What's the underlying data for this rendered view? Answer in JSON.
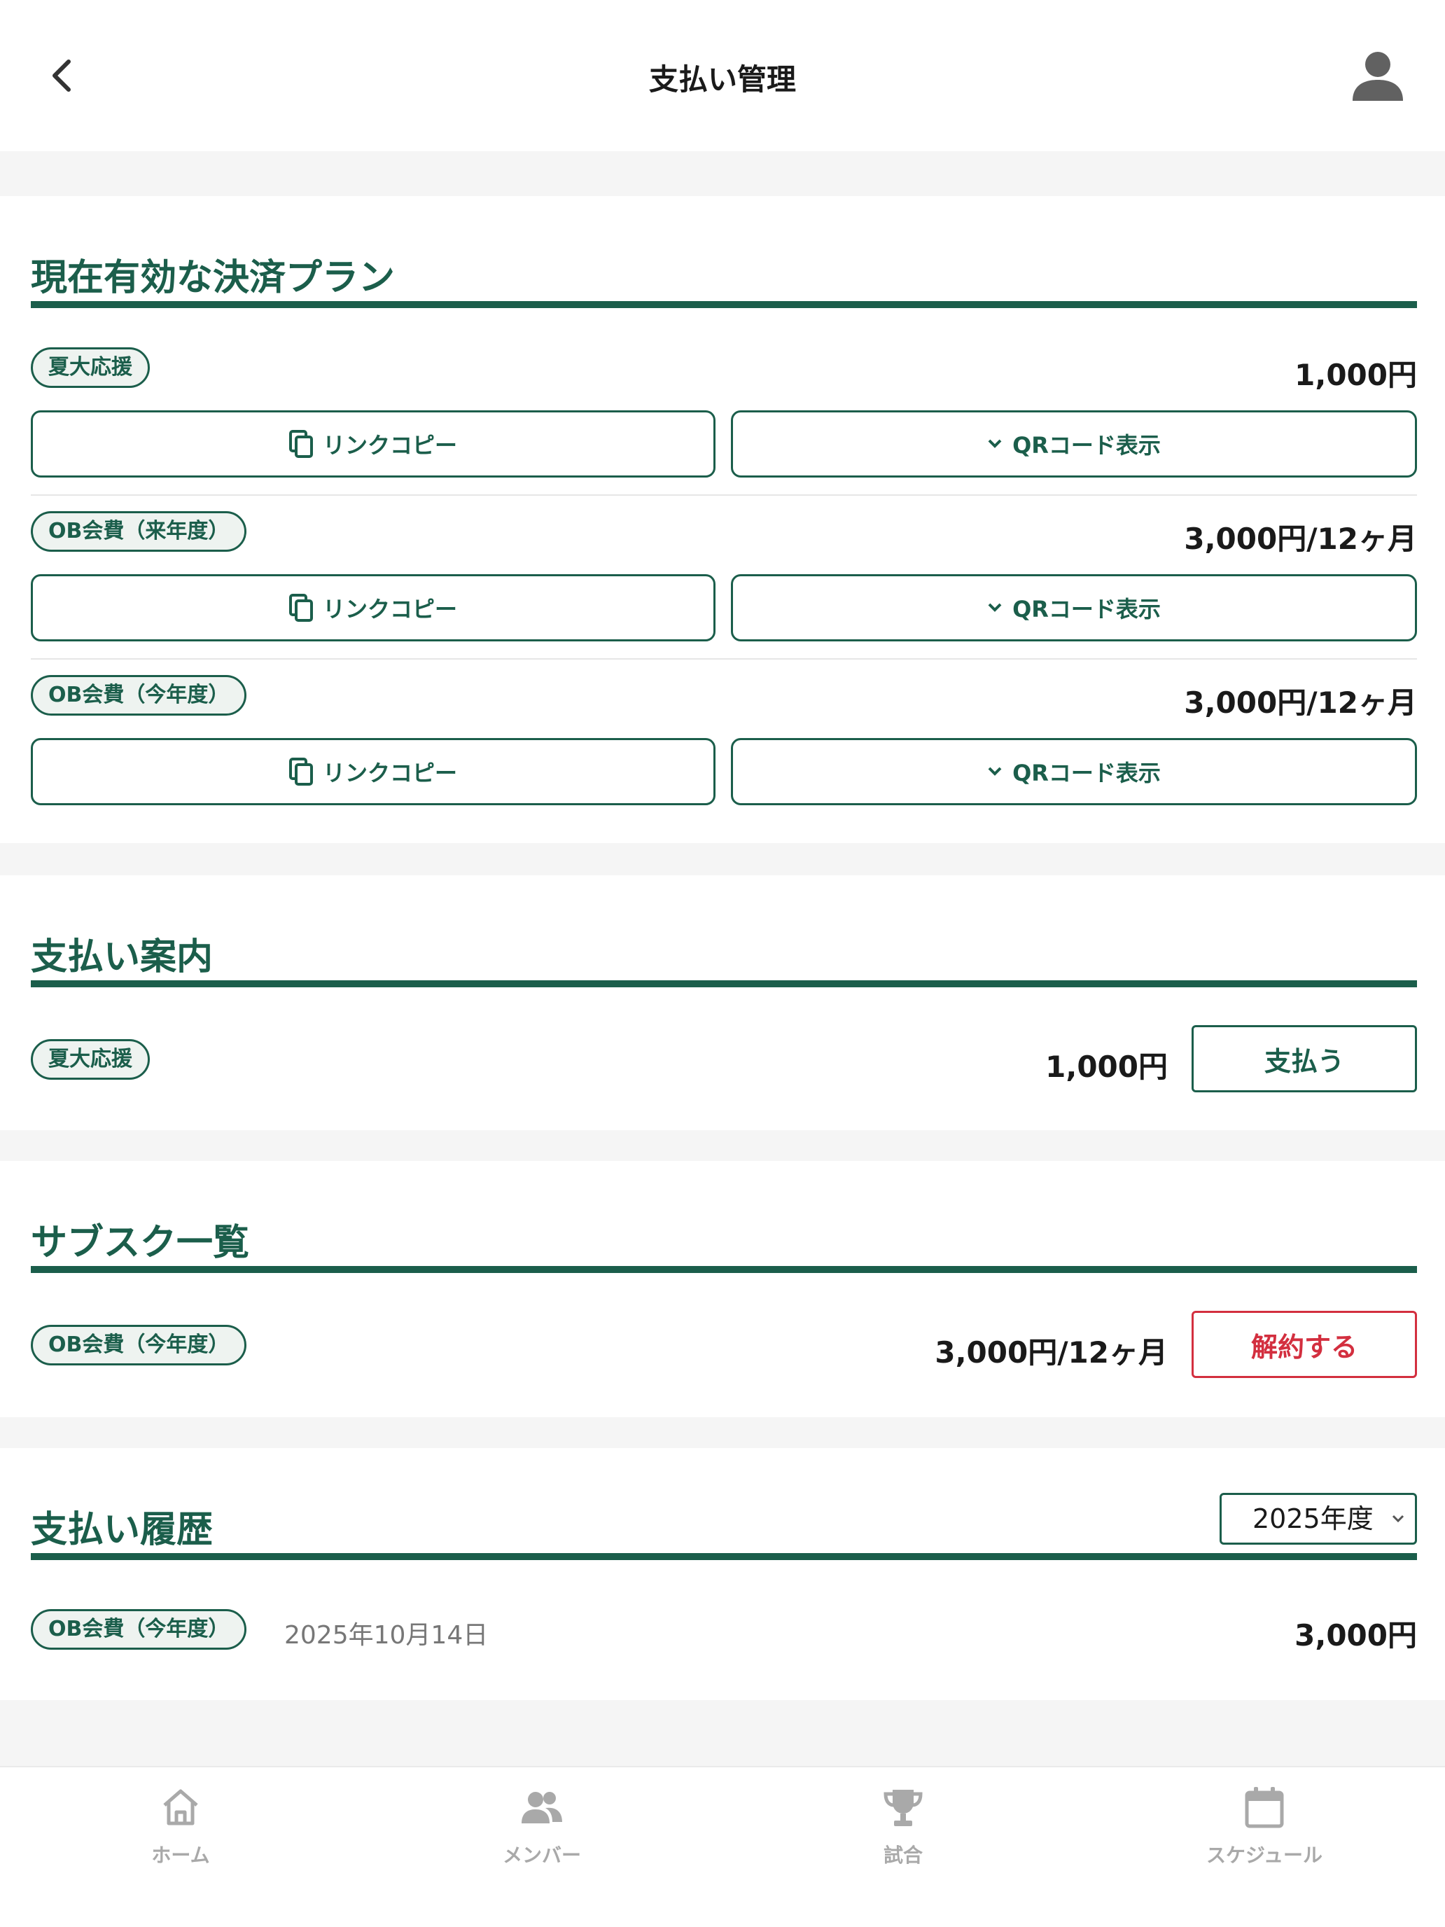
{
  "header": {
    "title": "支払い管理"
  },
  "plans": {
    "title": "現在有効な決済プラン",
    "items": [
      {
        "name": "夏大応援",
        "price": "1,000円",
        "copy_label": "リンクコピー",
        "qr_label": "QRコード表示"
      },
      {
        "name": "OB会費（来年度）",
        "price": "3,000円/12ヶ月",
        "copy_label": "リンクコピー",
        "qr_label": "QRコード表示"
      },
      {
        "name": "OB会費（今年度）",
        "price": "3,000円/12ヶ月",
        "copy_label": "リンクコピー",
        "qr_label": "QRコード表示"
      }
    ]
  },
  "guide": {
    "title": "支払い案内",
    "item": {
      "name": "夏大応援",
      "price": "1,000円",
      "pay_label": "支払う"
    }
  },
  "subscriptions": {
    "title": "サブスク一覧",
    "item": {
      "name": "OB会費（今年度）",
      "price": "3,000円/12ヶ月",
      "cancel_label": "解約する"
    }
  },
  "history": {
    "title": "支払い履歴",
    "year_select": "2025年度",
    "item": {
      "name": "OB会費（今年度）",
      "date": "2025年10月14日",
      "amount": "3,000円"
    }
  },
  "nav": {
    "items": [
      {
        "label": "ホーム",
        "icon": "home-icon"
      },
      {
        "label": "メンバー",
        "icon": "members-icon"
      },
      {
        "label": "試合",
        "icon": "trophy-icon"
      },
      {
        "label": "スケジュール",
        "icon": "calendar-icon"
      }
    ]
  },
  "colors": {
    "primary": "#1b5e4b",
    "danger": "#d32f3f",
    "muted": "#a9a9a9"
  }
}
